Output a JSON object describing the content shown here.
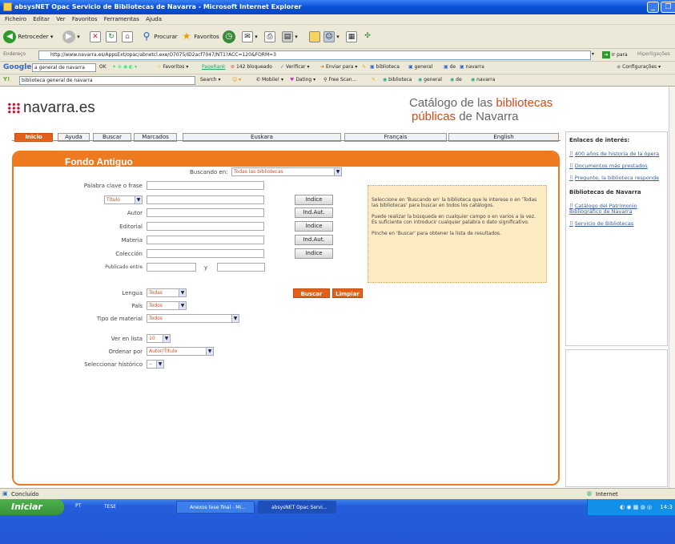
{
  "window": {
    "title": "absysNET Opac Servicio de Bibliotecas de Navarra - Microsoft Internet Explorer"
  },
  "menu": [
    "Ficheiro",
    "Editar",
    "Ver",
    "Favoritos",
    "Ferramentas",
    "Ajuda"
  ],
  "toolbar": {
    "back": "Retroceder",
    "search": "Procurar",
    "favorites": "Favoritos"
  },
  "address": {
    "label": "Endereço",
    "url": "http://www.navarra.es/AppsExt/opac/abnetcl.exe/O7075/ID2acf7047/NT1?ACC=120&FORM=3",
    "go": "Ir para",
    "links": "Hiperligações"
  },
  "googlebar": {
    "query": "a general de navarra",
    "go": "OK",
    "favorites": "Favoritos",
    "pagerank": "PageRank",
    "blocked": "142 bloqueado",
    "check": "Verificar",
    "send": "Enviar para",
    "terms": [
      "biblioteca",
      "general",
      "de",
      "navarra"
    ],
    "settings": "Configurações"
  },
  "linksbar": {
    "query": "biblioteca general de navarra",
    "search": "Search",
    "mobile": "Mobile!",
    "dating": "Dating",
    "freescan": "Free Scan...",
    "terms": [
      "biblioteca",
      "general",
      "de",
      "navarra"
    ]
  },
  "site": {
    "logo": "navarra.es",
    "catalog_line1_a": "Catálogo de las ",
    "catalog_line1_b": "bibliotecas",
    "catalog_line2_a": "públicas",
    "catalog_line2_b": " de Navarra"
  },
  "nav": [
    "Inicio",
    "Ayuda",
    "Buscar",
    "Marcados",
    "Euskara",
    "Français",
    "English"
  ],
  "form": {
    "title": "Fondo Antiguo",
    "buscando_label": "Buscando en:",
    "buscando_value": "Todas las bibliotecas",
    "palabra_label": "Palabra clave o frase",
    "titulo_value": "Título",
    "autor_label": "Autor",
    "editorial_label": "Editorial",
    "materia_label": "Materia",
    "coleccion_label": "Colección",
    "publicado_label": "Publicado entre",
    "y_label": "y",
    "indice": "Indice",
    "indaut": "Ind.Aut.",
    "lengua_label": "Lengua",
    "lengua_value": "Todas",
    "pais_label": "País",
    "pais_value": "Todos",
    "tipo_label": "Tipo de material",
    "tipo_value": "Todos",
    "verlista_label": "Ver en lista",
    "verlista_value": "10",
    "ordenar_label": "Ordenar por",
    "ordenar_value": "Autor/Título",
    "historico_label": "Seleccionar histórico",
    "historico_value": "--",
    "buscar": "Buscar",
    "limpiar": "Limpiar",
    "help1": "Seleccione en 'Buscando en' la biblioteca que le interese o en 'Todas las bibliotecas' para buscar en todos los catálogos.",
    "help2": "Puede realizar la búsqueda en cualquier campo o en varios a la vez. Es suficiente con introducir cualquier palabra o dato significativo.",
    "help3": "Pinche en 'Buscar' para obtener la lista de resultados."
  },
  "sidebar": {
    "heading": "Enlaces de interés:",
    "links": [
      "400 años de historia de la ópera",
      "Documentos más prestados",
      "Pregunte, la biblioteca responde"
    ],
    "heading2": "Bibliotecas de Navarra",
    "links2": [
      "Catálogo del Patrimonio Bibliográfico de Navarra",
      "Servicio de Bibliotecas"
    ]
  },
  "status": {
    "left": "Concluído",
    "zone": "Internet"
  },
  "taskbar": {
    "start": "Iniciar",
    "lang": "PT",
    "tasks": [
      "TESE",
      "Anexos tese final - Mi...",
      "absysNET Opac Servi..."
    ],
    "clock": "14:3"
  }
}
